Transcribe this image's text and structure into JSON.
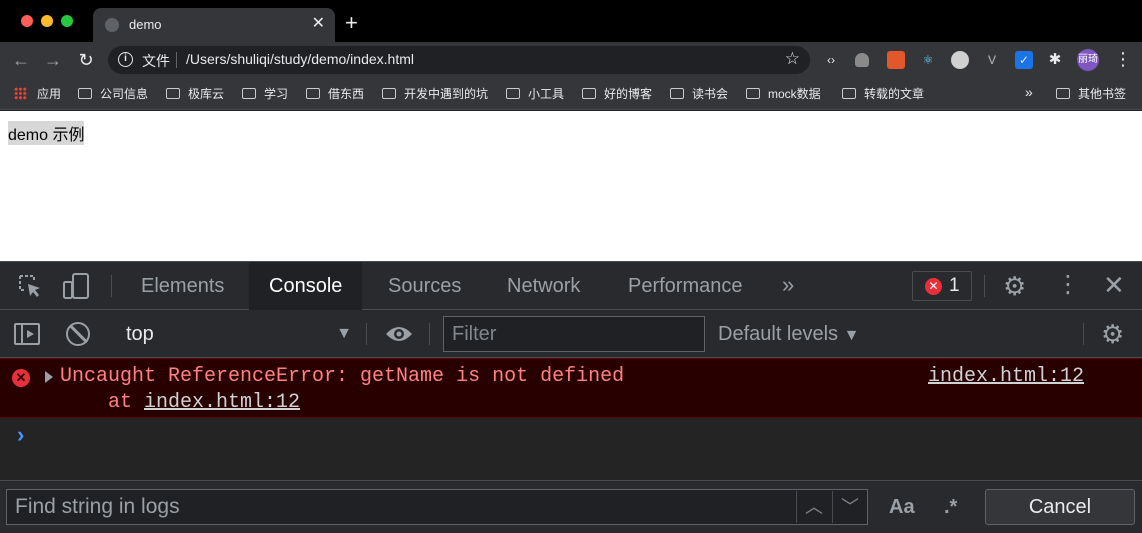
{
  "browser": {
    "tab_title": "demo",
    "tab_close": "✕",
    "new_tab": "+",
    "omnibox_label": "文件",
    "url": "/Users/shuliqi/study/demo/index.html",
    "avatar_text": "丽琦"
  },
  "bookmarks": [
    {
      "label": "应用",
      "kind": "apps"
    },
    {
      "label": "公司信息",
      "kind": "folder"
    },
    {
      "label": "极库云",
      "kind": "folder"
    },
    {
      "label": "学习",
      "kind": "folder"
    },
    {
      "label": "借东西",
      "kind": "folder"
    },
    {
      "label": "开发中遇到的坑",
      "kind": "folder"
    },
    {
      "label": "小工具",
      "kind": "folder"
    },
    {
      "label": "好的博客",
      "kind": "folder"
    },
    {
      "label": "读书会",
      "kind": "folder"
    },
    {
      "label": "mock数据",
      "kind": "folder"
    },
    {
      "label": "转载的文章",
      "kind": "folder"
    }
  ],
  "bookmarks_other": "其他书签",
  "page": {
    "text": "demo 示例"
  },
  "devtools": {
    "tabs": [
      "Elements",
      "Console",
      "Sources",
      "Network",
      "Performance"
    ],
    "active_tab": "Console",
    "error_count": "1",
    "context": "top",
    "filter_placeholder": "Filter",
    "levels_label": "Default levels",
    "console": {
      "error_message": "Uncaught ReferenceError: getName is not defined",
      "stack_prefix": "    at ",
      "stack_link": "index.html:12",
      "source_link": "index.html:12"
    },
    "find": {
      "placeholder": "Find string in logs",
      "case_label": "Aa",
      "regex_label": ".*",
      "cancel_label": "Cancel"
    }
  },
  "colors": {
    "error_text": "#ff8080",
    "error_bg": "#290000",
    "prompt": "#4d90fe",
    "error_badge": "#e8303b"
  }
}
